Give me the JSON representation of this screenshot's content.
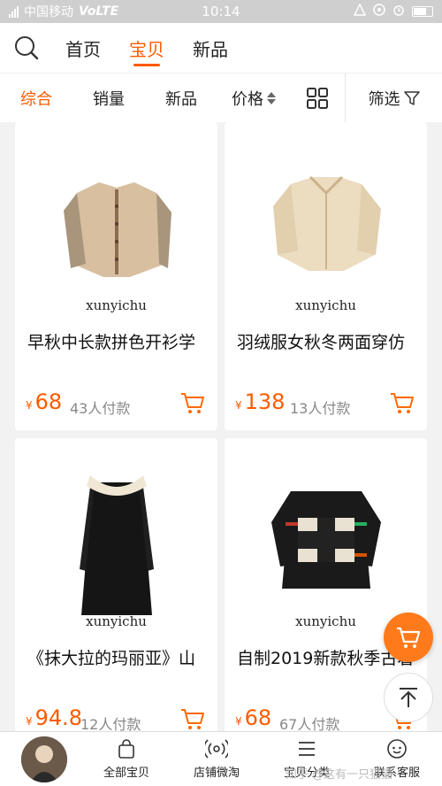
{
  "status": {
    "carrier": "中国移动",
    "network": "VoLTE",
    "time": "10:14"
  },
  "topnav": {
    "tabs": [
      "首页",
      "宝贝",
      "新品"
    ],
    "active": 1
  },
  "sortbar": {
    "items": [
      "综合",
      "销量",
      "新品",
      "价格"
    ],
    "active": 0,
    "filter_label": "筛选"
  },
  "products": [
    {
      "brand": "xunyichu",
      "title": "早秋中长款拼色开衫学",
      "currency": "¥",
      "price": "68",
      "sold": "43人付款"
    },
    {
      "brand": "xunyichu",
      "title": "羽绒服女秋冬两面穿仿",
      "currency": "¥",
      "price": "138",
      "sold": "13人付款"
    },
    {
      "brand": "xunyichu",
      "title": "《抹大拉的玛丽亚》山",
      "currency": "¥",
      "price": "94.8",
      "sold": "12人付款"
    },
    {
      "brand": "xunyichu",
      "title": "自制2019新款秋季古着",
      "currency": "¥",
      "price": "68",
      "sold": "67人付款"
    }
  ],
  "bottombar": {
    "items": [
      "全部宝贝",
      "店铺微淘",
      "宝贝分类",
      "联系客服"
    ]
  },
  "watermark": "知乎 @这有一只猫猫"
}
